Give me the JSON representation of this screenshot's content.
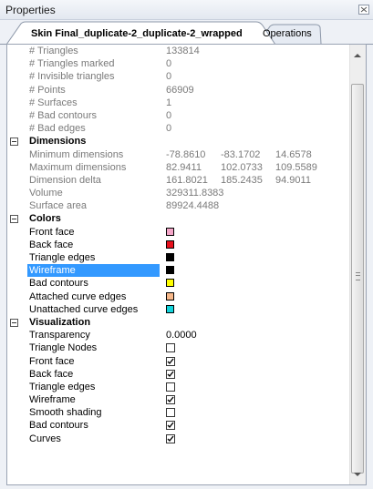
{
  "window": {
    "title": "Properties"
  },
  "tabs": [
    {
      "label": "Skin Final_duplicate-2_duplicate-2_wrapped",
      "active": true
    },
    {
      "label": "Operations",
      "active": false
    }
  ],
  "stats": [
    {
      "label": "# Triangles",
      "value": "133814"
    },
    {
      "label": "# Triangles marked",
      "value": "0"
    },
    {
      "label": "# Invisible triangles",
      "value": "0"
    },
    {
      "label": "# Points",
      "value": "66909"
    },
    {
      "label": "# Surfaces",
      "value": "1"
    },
    {
      "label": "# Bad contours",
      "value": "0"
    },
    {
      "label": "# Bad edges",
      "value": "0"
    }
  ],
  "dimensions": {
    "label": "Dimensions",
    "rows": [
      {
        "label": "Minimum dimensions",
        "values": [
          "-78.8610",
          "-83.1702",
          "14.6578"
        ]
      },
      {
        "label": "Maximum dimensions",
        "values": [
          "82.9411",
          "102.0733",
          "109.5589"
        ]
      },
      {
        "label": "Dimension delta",
        "values": [
          "161.8021",
          "185.2435",
          "94.9011"
        ]
      },
      {
        "label": "Volume",
        "values": [
          "329311.8383"
        ]
      },
      {
        "label": "Surface area",
        "values": [
          "89924.4488"
        ]
      }
    ]
  },
  "colors": {
    "label": "Colors",
    "rows": [
      {
        "label": "Front face",
        "color": "#f4a6c8"
      },
      {
        "label": "Back face",
        "color": "#e8101c"
      },
      {
        "label": "Triangle edges",
        "color": "#000000"
      },
      {
        "label": "Wireframe",
        "color": "#000000",
        "selected": true
      },
      {
        "label": "Bad contours",
        "color": "#ffff00"
      },
      {
        "label": "Attached curve edges",
        "color": "#f7b88a"
      },
      {
        "label": "Unattached curve edges",
        "color": "#13d4dc"
      }
    ]
  },
  "visualization": {
    "label": "Visualization",
    "rows": [
      {
        "label": "Transparency",
        "value": "0.0000"
      },
      {
        "label": "Triangle Nodes",
        "checked": false
      },
      {
        "label": "Front face",
        "checked": true
      },
      {
        "label": "Back face",
        "checked": true
      },
      {
        "label": "Triangle edges",
        "checked": false
      },
      {
        "label": "Wireframe",
        "checked": true
      },
      {
        "label": "Smooth shading",
        "checked": false
      },
      {
        "label": "Bad contours",
        "checked": true
      },
      {
        "label": "Curves",
        "checked": true
      }
    ]
  }
}
